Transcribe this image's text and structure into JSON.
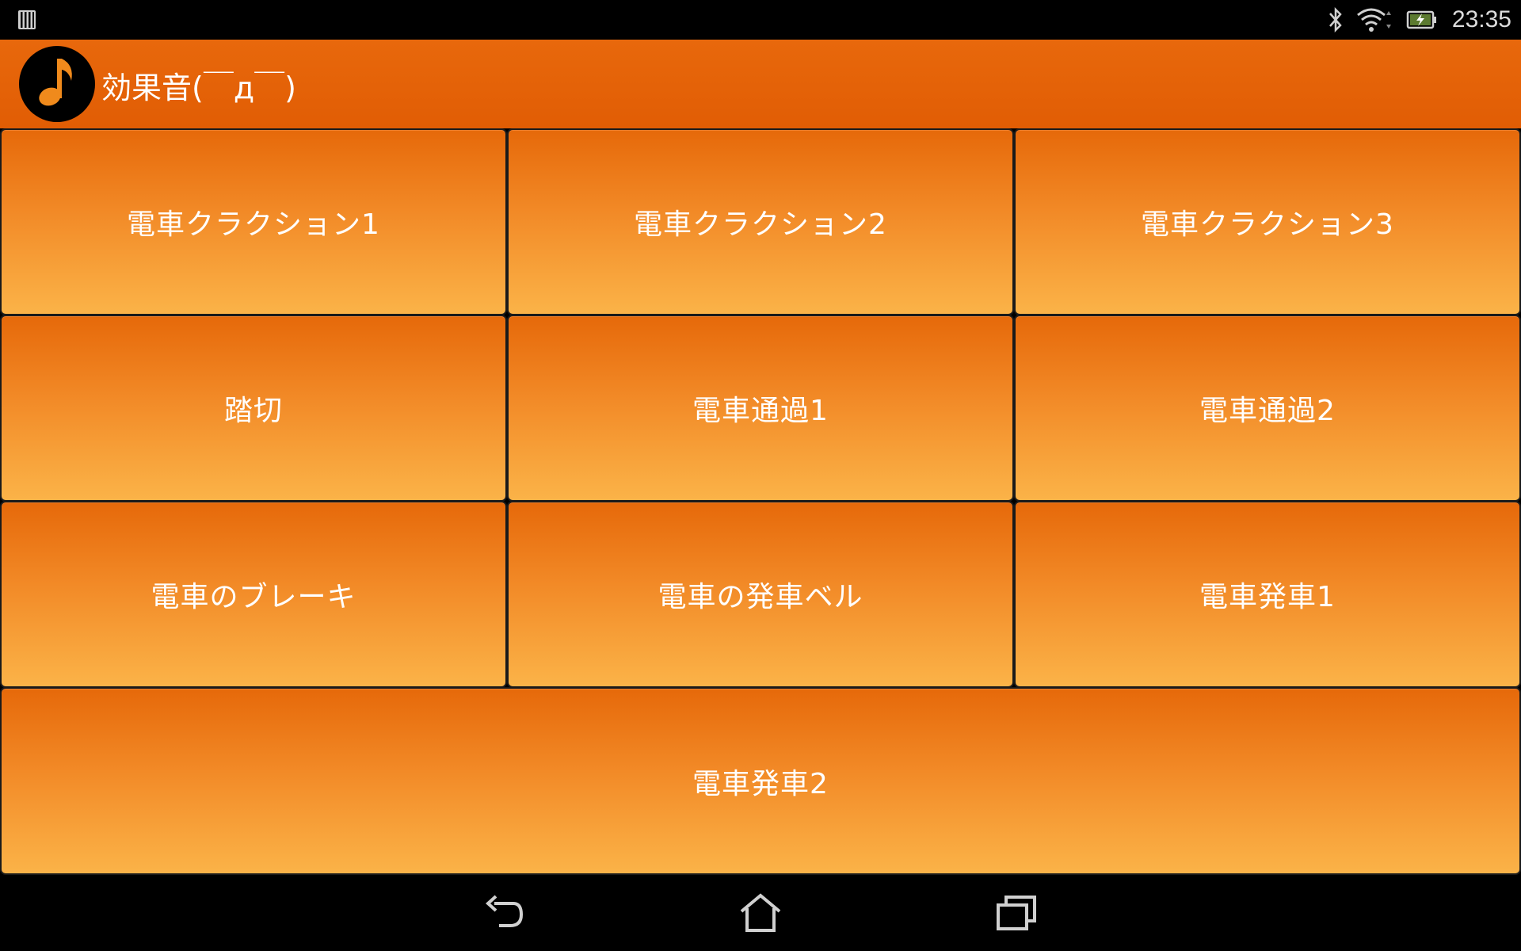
{
  "status_bar": {
    "time": "23:35",
    "icons": [
      "sim-card-icon",
      "bluetooth-icon",
      "wifi-icon",
      "battery-charging-icon"
    ]
  },
  "app": {
    "title": "効果音(￣д￣)",
    "icon": "music-note-icon"
  },
  "buttons": [
    "電車クラクション1",
    "電車クラクション2",
    "電車クラクション3",
    "踏切",
    "電車通過1",
    "電車通過2",
    "電車のブレーキ",
    "電車の発車ベル",
    "電車発車1",
    "電車発車2"
  ],
  "nav_bar": {
    "icons": [
      "back-icon",
      "home-icon",
      "recent-apps-icon"
    ]
  },
  "colors": {
    "action_bar": "#e15d04",
    "button_top": "#e6690a",
    "button_bottom": "#fbb348"
  }
}
